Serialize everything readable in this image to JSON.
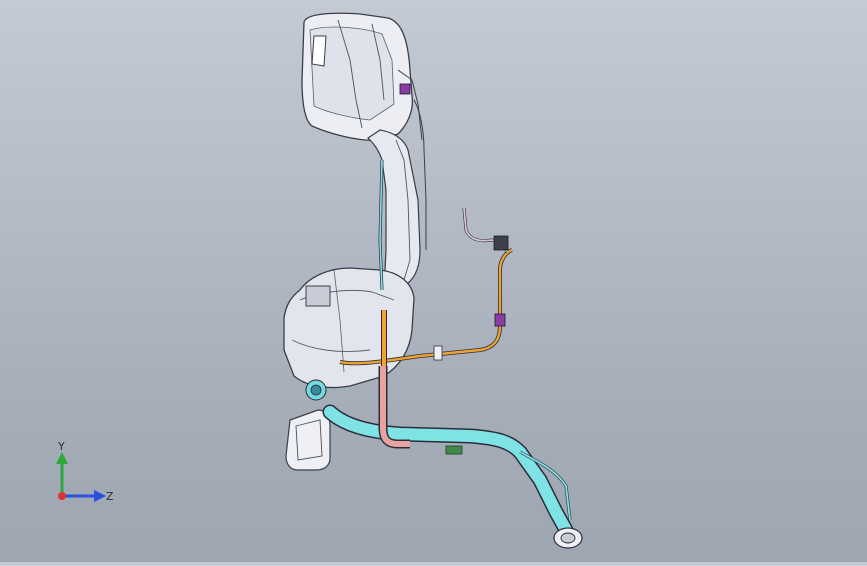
{
  "view": {
    "background_top": "#c4cad3",
    "background_bottom": "#9ea6b2",
    "model_colors": {
      "tank_body": "#e6e8ef",
      "tank_edge": "#3a3d48",
      "filler_pipe": "#7fe3e6",
      "vent_line": "#f0a430",
      "return_pipe": "#e8a39e",
      "harness": "#d6c0dc"
    }
  },
  "triad": {
    "y_label": "Y",
    "z_label": "Z",
    "x_color": "#e03030",
    "y_color": "#2fa83a",
    "z_color": "#2c4fe0"
  }
}
